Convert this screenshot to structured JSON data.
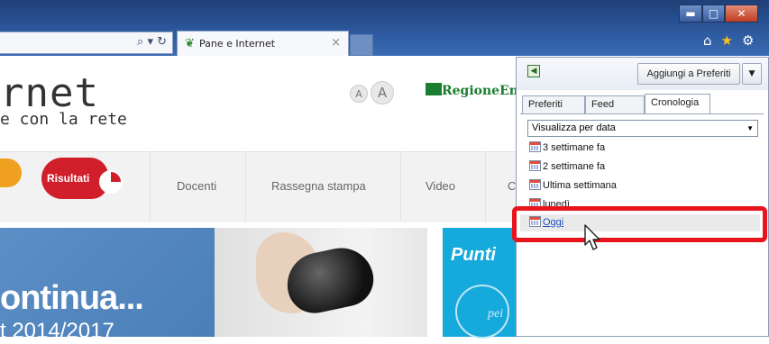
{
  "browser": {
    "tab_title": "Pane e Internet",
    "tab_close": "×",
    "address_icons": "⌕ ▾ ↻",
    "window_buttons": {
      "minimize": "▬",
      "maximize": "□",
      "close": "✕"
    },
    "command_icons": [
      "home-icon",
      "star-icon",
      "gear-icon"
    ]
  },
  "page": {
    "logo_main": "rnet",
    "logo_sub": "e con la rete",
    "font_small": "A",
    "font_large": "A",
    "region_logo": "RegioneEmi",
    "nav_items": [
      "Risultati",
      "Docenti",
      "Rassegna stampa",
      "Video",
      "C"
    ],
    "hero_text": "ontinua...",
    "hero_year": "t 2014/2017",
    "side_banner_title": "Punti",
    "side_banner_circle": "pei"
  },
  "favorites_pane": {
    "add_button": "Aggiungi a Preferiti",
    "add_dropdown": "▼",
    "tabs": [
      "Preferiti",
      "Feed",
      "Cronologia"
    ],
    "active_tab": "Cronologia",
    "view_select": "Visualizza per data",
    "history_items": [
      "3 settimane fa",
      "2 settimane fa",
      "Ultima settimana",
      "lunedì",
      "Oggi"
    ]
  },
  "colors": {
    "highlight": "#e8151c",
    "titlebar": "#2d5aa0",
    "link": "#1a4fc2",
    "regione_green": "#1b7d2f",
    "risultati_red": "#d01f2a"
  }
}
